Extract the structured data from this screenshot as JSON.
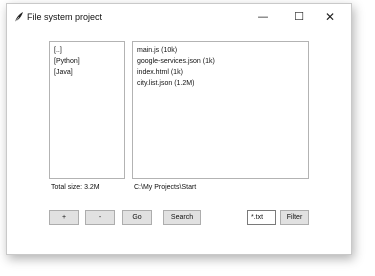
{
  "window": {
    "title": "File system project",
    "icon": "feather-icon",
    "controls": {
      "minimize": "—",
      "maximize": "☐",
      "close": "✕"
    }
  },
  "directory_list": {
    "items": [
      {
        "label": "[..]"
      },
      {
        "label": "[Python]"
      },
      {
        "label": "[Java]"
      }
    ]
  },
  "file_list": {
    "items": [
      {
        "label": "main.js (10k)"
      },
      {
        "label": "google-services.json (1k)"
      },
      {
        "label": "index.html (1k)"
      },
      {
        "label": "city.list.json (1.2M)"
      }
    ]
  },
  "status": {
    "total_size": "Total size: 3.2M",
    "current_path": "C:\\My Projects\\Start"
  },
  "toolbar": {
    "plus_label": "+",
    "minus_label": "-",
    "go_label": "Go",
    "search_label": "Search",
    "filter_value": "*.txt",
    "filter_label": "Filter"
  }
}
